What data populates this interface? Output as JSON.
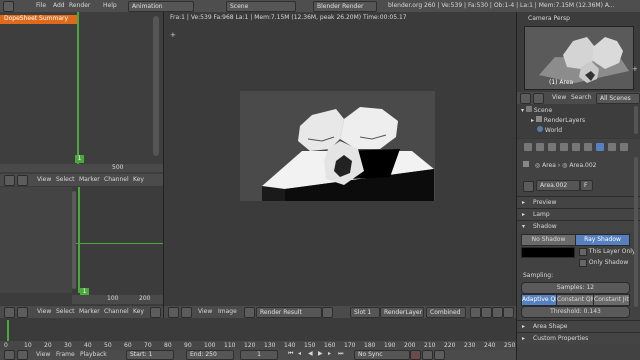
{
  "topbar": {
    "menu": [
      "File",
      "Add",
      "Render",
      "Help"
    ],
    "layout": "Animation",
    "scene": "Scene",
    "engine": "Blender Render",
    "stats": "blender.org 260 | Ve:539 | Fa:530 | Ob:1-4 | La:1 | Mem:7.15M (12.36M) A..."
  },
  "dopesheet": {
    "summary_label": "DopeSheet Summary",
    "frame_marker": "1",
    "ruler_value": "500",
    "menu": [
      "View",
      "Select",
      "Marker",
      "Channel",
      "Key"
    ]
  },
  "graph": {
    "frame_marker": "1",
    "ruler": [
      "100",
      "200"
    ],
    "menu": [
      "View",
      "Select",
      "Marker",
      "Channel",
      "Key"
    ]
  },
  "render_view": {
    "info": "Fra:1 | Ve:539 Fa:968 La:1 | Mem:7.15M (12.36M, peak 26.20M) Time:00:05.17",
    "menu": [
      "View",
      "Image"
    ],
    "image_name": "Render Result",
    "slot": "Slot 1",
    "layer": "RenderLayer",
    "pass": "Combined"
  },
  "camera_view": {
    "title": "Camera Persp",
    "object_label": "(1) Area"
  },
  "outliner": {
    "menu": [
      "View",
      "Search"
    ],
    "filter": "All Scenes",
    "items": [
      "Scene",
      "RenderLayers",
      "World"
    ]
  },
  "properties": {
    "breadcrumb": [
      "Area",
      "Area.002"
    ],
    "datablock": "Area.002",
    "datablock_flag": "F",
    "panels": {
      "preview": "Preview",
      "lamp": "Lamp",
      "shadow": "Shadow",
      "area_shape": "Area Shape",
      "custom_props": "Custom Properties"
    },
    "shadow_modes": [
      "No Shadow",
      "Ray Shadow"
    ],
    "shadow_active": "Ray Shadow",
    "this_layer_only": "This Layer Only",
    "only_shadow": "Only Shadow",
    "sampling_label": "Sampling:",
    "samples": "Samples: 12",
    "qmc_modes": [
      "Adaptive QM",
      "Constant QMC",
      "Constant Jitter"
    ],
    "threshold": "Threshold: 0.143"
  },
  "timeline": {
    "ruler": [
      "0",
      "10",
      "20",
      "30",
      "40",
      "50",
      "60",
      "70",
      "80",
      "90",
      "100",
      "110",
      "120",
      "130",
      "140",
      "150",
      "160",
      "170",
      "180",
      "190",
      "200",
      "210",
      "220",
      "230",
      "240",
      "250"
    ],
    "menu": [
      "View",
      "Frame",
      "Playback"
    ],
    "start": "Start: 1",
    "end": "End: 250",
    "current": "1",
    "sync": "No Sync"
  },
  "colors": {
    "accent": "#5680c2",
    "dopesheet_summary": "#e06a1c",
    "playhead": "#4aa83c"
  }
}
